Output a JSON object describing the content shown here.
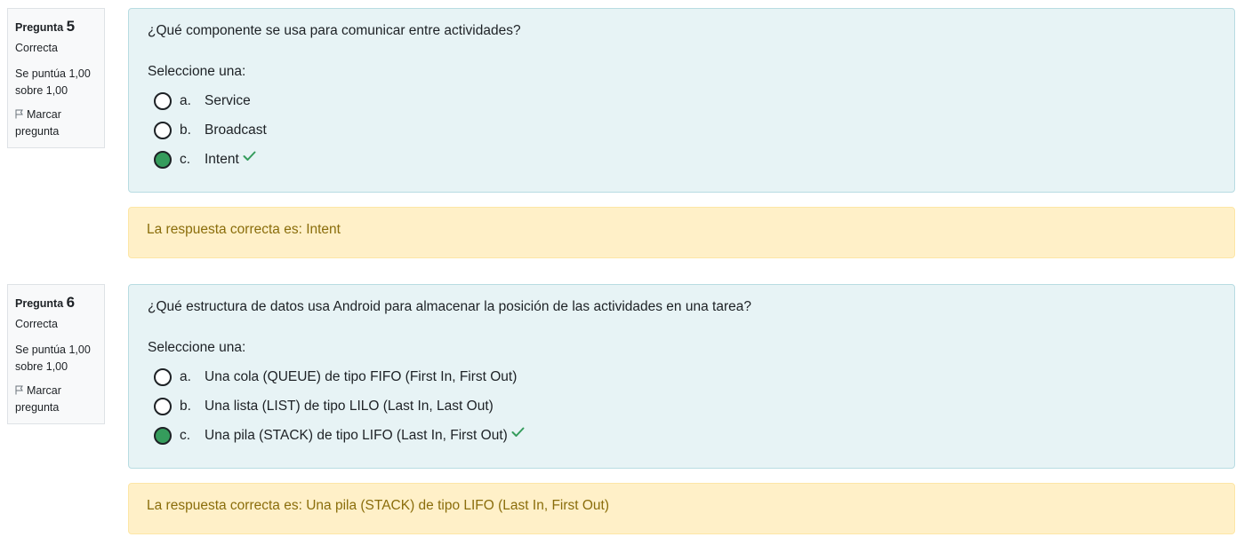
{
  "questions": [
    {
      "label": "Pregunta",
      "number": "5",
      "state": "Correcta",
      "grade_line1": "Se puntúa 1,00",
      "grade_line2": "sobre 1,00",
      "flag_line1": "Marcar",
      "flag_line2": "pregunta",
      "text": "¿Qué componente se usa para comunicar entre actividades?",
      "prompt": "Seleccione una:",
      "options": [
        {
          "letter": "a.",
          "text": "Service",
          "selected": false
        },
        {
          "letter": "b.",
          "text": "Broadcast",
          "selected": false
        },
        {
          "letter": "c.",
          "text": "Intent",
          "selected": true
        }
      ],
      "feedback": "La respuesta correcta es: Intent"
    },
    {
      "label": "Pregunta",
      "number": "6",
      "state": "Correcta",
      "grade_line1": "Se puntúa 1,00",
      "grade_line2": "sobre 1,00",
      "flag_line1": "Marcar",
      "flag_line2": "pregunta",
      "text": "¿Qué estructura de datos usa Android para almacenar la posición de las actividades en una tarea?",
      "prompt": "Seleccione una:",
      "options": [
        {
          "letter": "a.",
          "text": "Una cola (QUEUE) de tipo FIFO (First In, First Out)",
          "selected": false
        },
        {
          "letter": "b.",
          "text": "Una lista (LIST) de tipo LILO (Last In, Last Out)",
          "selected": false
        },
        {
          "letter": "c.",
          "text": "Una pila (STACK) de tipo LIFO (Last In, First Out)",
          "selected": true
        }
      ],
      "feedback": "La respuesta correcta es: Una pila (STACK) de tipo LIFO (Last In, First Out)"
    }
  ],
  "colors": {
    "selected_radio": "#359c5c",
    "correct_check": "#359c5c",
    "question_bg": "#e7f3f5",
    "feedback_bg": "#fff0c8",
    "feedback_text": "#8a6d0b"
  }
}
